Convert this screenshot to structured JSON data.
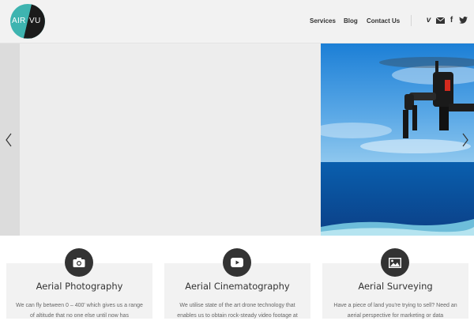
{
  "header": {
    "logo": {
      "left_text": "AIR",
      "right_text": "VU",
      "colors": {
        "left": "#3eb4b0",
        "right": "#1b1b1b"
      }
    },
    "nav": [
      {
        "label": "Services"
      },
      {
        "label": "Blog"
      },
      {
        "label": "Contact Us"
      }
    ],
    "social": [
      {
        "icon": "vimeo-icon",
        "glyph": "v"
      },
      {
        "icon": "mail-icon"
      },
      {
        "icon": "facebook-icon",
        "glyph": "f"
      },
      {
        "icon": "twitter-icon"
      }
    ]
  },
  "slider": {
    "prev_icon": "chevron-left-icon",
    "next_icon": "chevron-right-icon",
    "image": "drone-over-sea"
  },
  "cards": [
    {
      "icon": "camera-icon",
      "title": "Aerial Photography",
      "text": "We can fly between 0 – 400' which gives us a range of altitude that no one else until now has"
    },
    {
      "icon": "youtube-play-icon",
      "title": "Aerial Cinematography",
      "text": "We utilise state of the art drone technology that enables us to obtain rock-steady video footage at"
    },
    {
      "icon": "image-icon",
      "title": "Aerial Surveying",
      "text": "Have a piece of land you're trying to sell? Need an aerial perspective for marketing or data"
    }
  ],
  "colors": {
    "header_bg": "#f2f2f2",
    "card_bg": "#f2f2f2",
    "icon_circle": "#333333",
    "text": "#333333"
  }
}
